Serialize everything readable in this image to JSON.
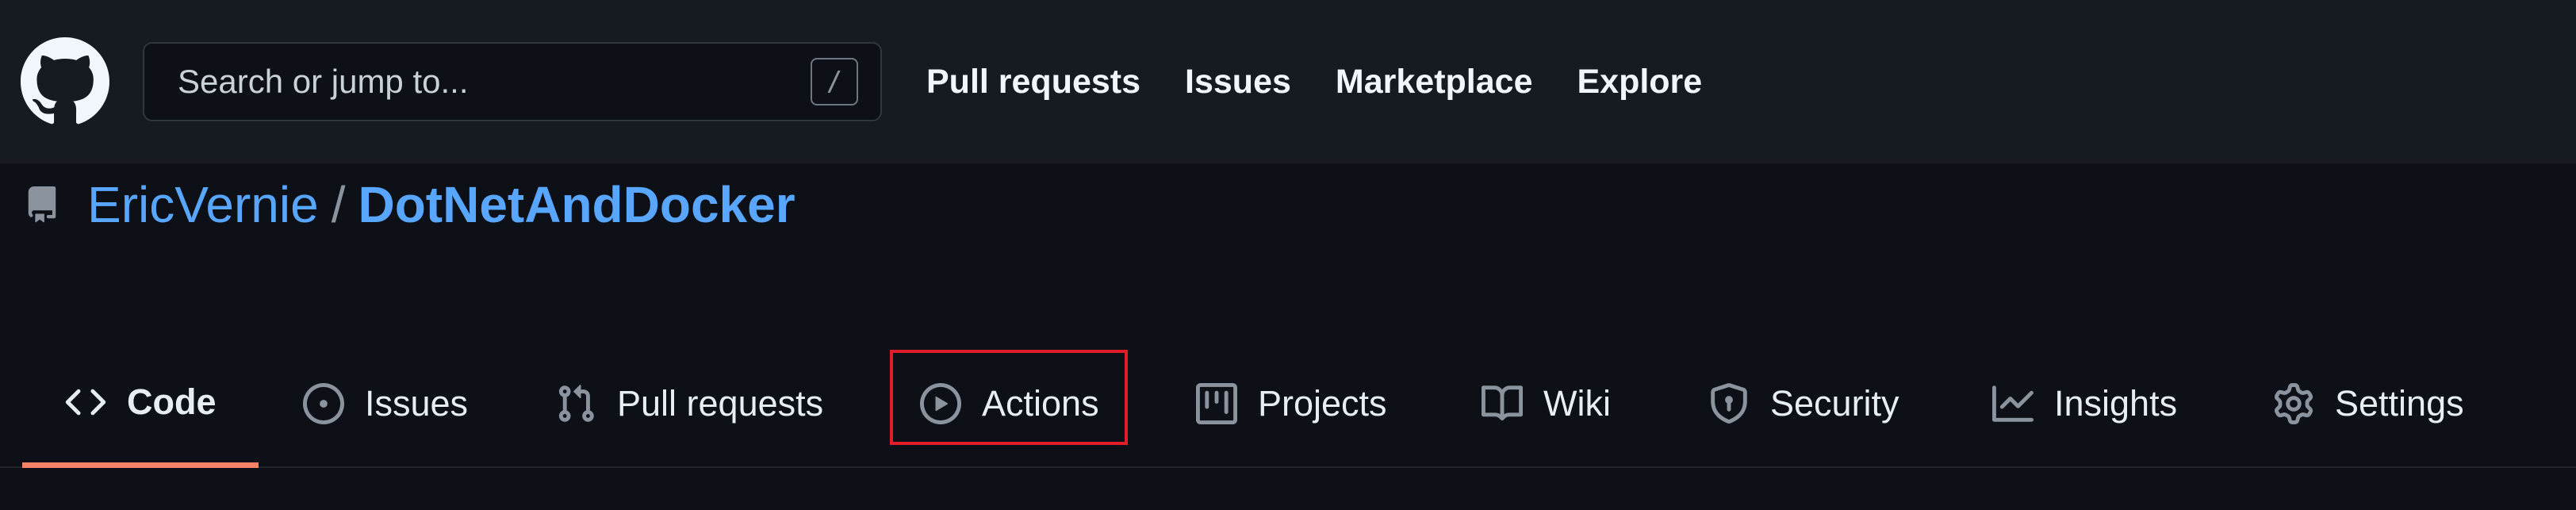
{
  "header": {
    "search_placeholder": "Search or jump to...",
    "search_shortcut": "/",
    "nav": [
      "Pull requests",
      "Issues",
      "Marketplace",
      "Explore"
    ]
  },
  "repo": {
    "owner": "EricVernie",
    "separator": "/",
    "name": "DotNetAndDocker"
  },
  "tabs": [
    {
      "label": "Code",
      "icon": "code-icon",
      "selected": true
    },
    {
      "label": "Issues",
      "icon": "issue-opened-icon",
      "selected": false
    },
    {
      "label": "Pull requests",
      "icon": "git-pull-request-icon",
      "selected": false
    },
    {
      "label": "Actions",
      "icon": "play-icon",
      "selected": false,
      "highlighted": true
    },
    {
      "label": "Projects",
      "icon": "table-icon",
      "selected": false
    },
    {
      "label": "Wiki",
      "icon": "book-icon",
      "selected": false
    },
    {
      "label": "Security",
      "icon": "shield-icon",
      "selected": false
    },
    {
      "label": "Insights",
      "icon": "graph-icon",
      "selected": false
    },
    {
      "label": "Settings",
      "icon": "gear-icon",
      "selected": false
    }
  ],
  "colors": {
    "header_bg": "#161b22",
    "page_bg": "#0d1117",
    "link": "#58a6ff",
    "selected_underline": "#f78166",
    "annotation_box": "#e11d2a"
  }
}
